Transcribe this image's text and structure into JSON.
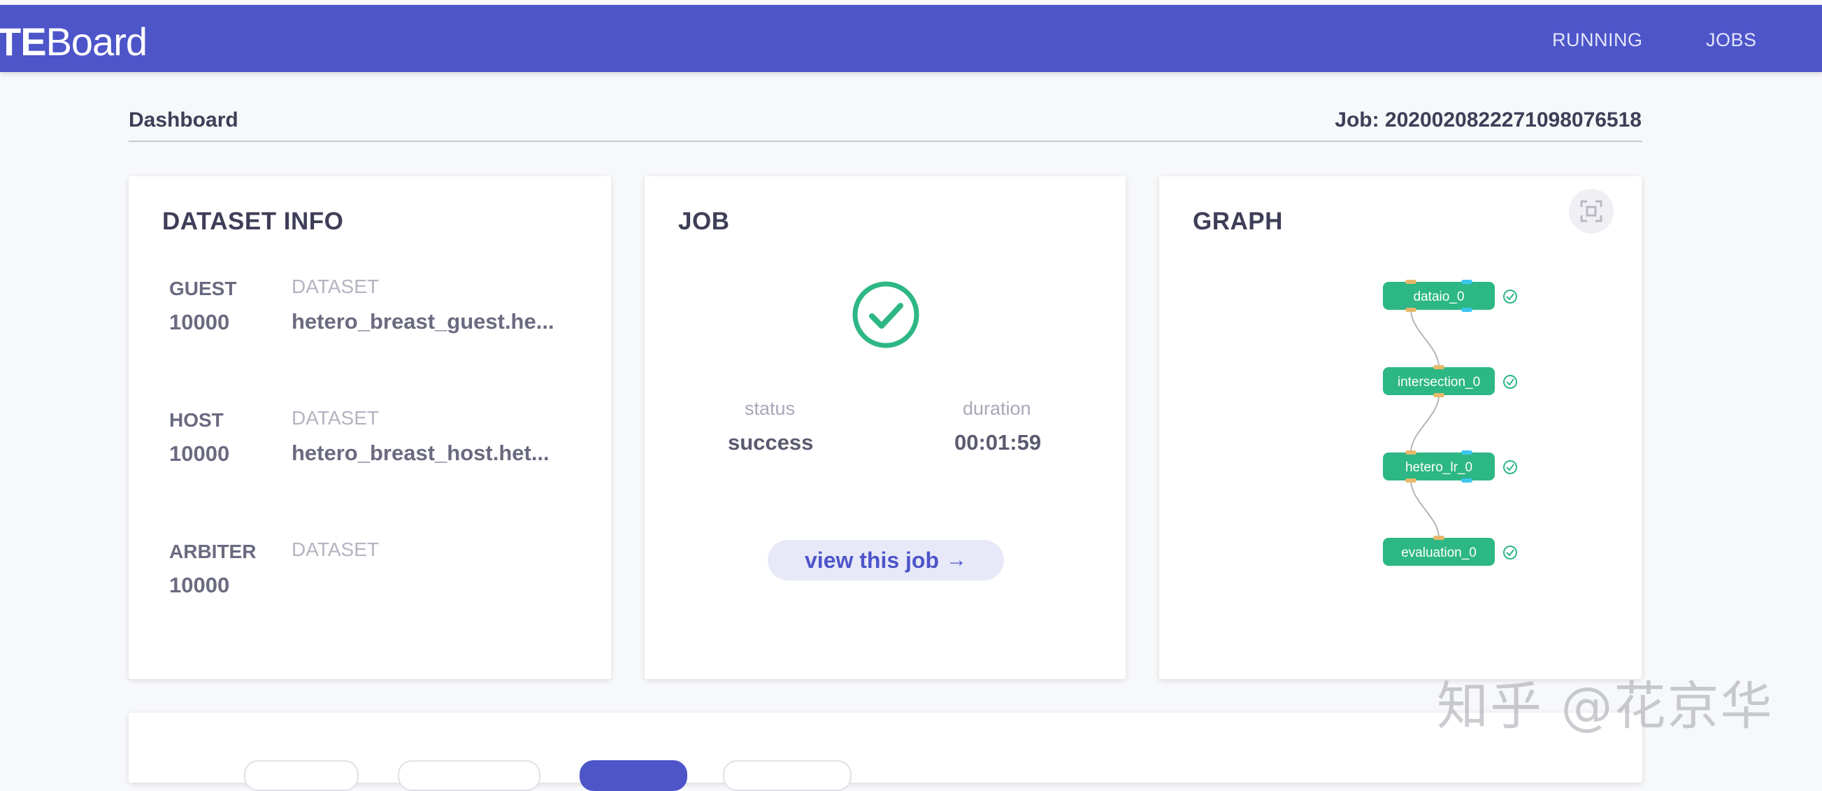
{
  "header": {
    "logo_bold": "TE",
    "logo_light": "Board",
    "nav": {
      "running": "RUNNING",
      "jobs": "JOBS"
    }
  },
  "page": {
    "breadcrumb": "Dashboard",
    "job_id": "Job: 202002082227109807651​8"
  },
  "dataset_info": {
    "title": "DATASET INFO",
    "rows": [
      {
        "role": "GUEST",
        "count": "10000",
        "label": "DATASET",
        "name": "hetero_breast_guest.he..."
      },
      {
        "role": "HOST",
        "count": "10000",
        "label": "DATASET",
        "name": "hetero_breast_host.het..."
      },
      {
        "role": "ARBITER",
        "count": "10000",
        "label": "DATASET",
        "name": ""
      }
    ]
  },
  "job": {
    "title": "JOB",
    "status_label": "status",
    "status_value": "success",
    "duration_label": "duration",
    "duration_value": "00:01:59",
    "view_button": "view this job",
    "view_arrow": "→"
  },
  "graph": {
    "title": "GRAPH",
    "nodes": [
      {
        "label": "dataio_0",
        "status": "success"
      },
      {
        "label": "intersection_0",
        "status": "success"
      },
      {
        "label": "hetero_lr_0",
        "status": "success"
      },
      {
        "label": "evaluation_0",
        "status": "success"
      }
    ]
  },
  "colors": {
    "header": "#4d55c9",
    "success": "#2db784",
    "node_port_data": "#e8b86a",
    "node_port_model": "#3cc6ef"
  },
  "icons": {
    "status": "check-circle-icon",
    "fullscreen": "fullscreen-icon",
    "node_status": "check-circle-small-icon"
  },
  "watermark": "知乎 @花京华"
}
